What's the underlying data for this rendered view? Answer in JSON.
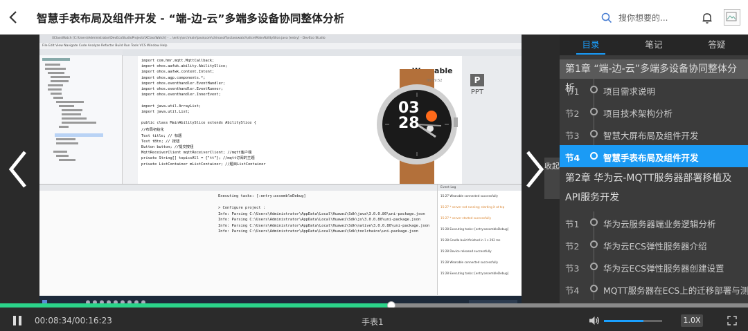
{
  "header": {
    "title": "智慧手表布局及组件开发 - “端-边-云”多端多设备协同整体分析",
    "search_placeholder": "搜你想要的..."
  },
  "player": {
    "collapse_label": "收起",
    "ide": {
      "title_text": "XClassWatch [C:\\Users\\Administrator\\DevEcoStudioProjects\\XClassWatch] - ...\\entry\\src\\main\\java\\com\\chinasoft\\xclasswatch\\slice\\MainAbilitySlice.java [entry] - DevEco Studio",
      "menu_text": "File  Edit  View  Navigate  Code  Analyze  Refactor  Build  Run  Tools  VCS  Window  Help",
      "code_lines": [
        "import com.hmr.mqtt.MqttCallback;",
        "import ohos.aafwk.ability.AbilitySlice;",
        "import ohos.aafwk.content.Intent;",
        "import ohos.agp.components.*;",
        "import ohos.eventhandler.EventHandler;",
        "import ohos.eventhandler.EventRunner;",
        "import ohos.eventhandler.InnerEvent;",
        "",
        "import java.util.ArrayList;",
        "import java.util.List;",
        "",
        "public class MainAbilitySlice extends AbilitySlice {",
        "    //布局初始化",
        "    Text title;  // 标题",
        "    Text tBtn;   // 按钮",
        "    Button button; //提交按钮",
        "    MqttReceiverClient mqttReceiverClient;   //mqtt客户端",
        "    private String[] topicsAll = {\"tt\"};      //mqtt订阅的主题",
        "    private ListContainer mListContainer;  //题目ListContainer"
      ],
      "console_lines": [
        "Executing tasks: [:entry:assembleDebug]",
        "",
        "> Configure project :",
        "Info: Parsing C:\\Users\\Administrator\\AppData\\Local\\Huawei\\Sdk\\java\\3.0.0.80\\uni-package.json",
        "Info: Parsing C:\\Users\\Administrator\\AppData\\Local\\Huawei\\Sdk\\js\\3.0.0.80\\uni-package.json",
        "Info: Parsing C:\\Users\\Administrator\\AppData\\Local\\Huawei\\Sdk\\native\\3.0.0.80\\uni-package.json",
        "Info: Parsing C:\\Users\\Administrator\\AppData\\Local\\Huawei\\Sdk\\toolchains\\uni-package.json"
      ],
      "event_log": [
        "15:27  Wearable connected successfully",
        "15:27  * server not running; starting it at tcp",
        "15:27  * server started successfully",
        "15:28  Executing tasks: [entry:assembleDebug]",
        "15:28  Gradle build finished in 1 s 292 ms",
        "15:28  Device released successfully",
        "15:28  Wearable connected successfully",
        "15:28  Executing tasks: [entry:assembleDebug]"
      ],
      "watch": {
        "device_label": "Wearable",
        "time_small": "00:59:52",
        "hour": "03",
        "minute": "28",
        "ppt_label": "PPT"
      }
    }
  },
  "sidebar": {
    "tabs": [
      "目录",
      "笔记",
      "答疑"
    ],
    "chapter1": "第1章 “端-边-云”多端多设备协同整体分析",
    "chapter1_sections": [
      {
        "num": "节1",
        "title": "项目需求说明"
      },
      {
        "num": "节2",
        "title": "项目技术架构分析"
      },
      {
        "num": "节3",
        "title": "智慧大屏布局及组件开发"
      },
      {
        "num": "节4",
        "title": "智慧手表布局及组件开发"
      }
    ],
    "chapter2": "第2章 华为云-MQTT服务器部署移植及API服务开发",
    "chapter2_sections": [
      {
        "num": "节1",
        "title": "华为云服务器端业务逻辑分析"
      },
      {
        "num": "节2",
        "title": "华为云ECS弹性服务器介绍"
      },
      {
        "num": "节3",
        "title": "华为云ECS弹性服务器创建设置"
      },
      {
        "num": "节4",
        "title": "MQTT服务器在ECS上的迁移部署与测试"
      }
    ]
  },
  "controls": {
    "time_display": "00:08:34/00:16:23",
    "progress_fraction": 0.523,
    "current_title": "手表1",
    "volume_fraction": 0.68,
    "speed_label": "1.0X"
  },
  "colors": {
    "accent": "#1aa0ff",
    "active_row": "#1b9bf5",
    "progress": "#2bd48a"
  }
}
